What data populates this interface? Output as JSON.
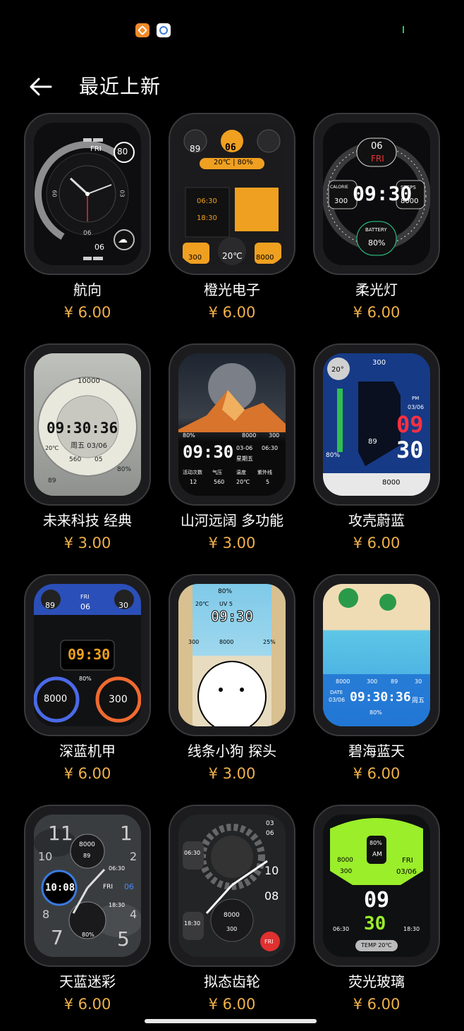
{
  "status": {
    "app_icons": [
      "orange-app-icon",
      "cloud-app-icon"
    ]
  },
  "header": {
    "title": "最近上新",
    "back_icon": "back-arrow-icon"
  },
  "colors": {
    "price": "#f0b14a",
    "background": "#000000"
  },
  "items": [
    {
      "name": "航向",
      "price": "¥ 6.00",
      "face": {
        "day": "FRI",
        "hr": "80",
        "n60": "60",
        "n03": "03",
        "n06": "06",
        "d06": "06"
      }
    },
    {
      "name": "橙光电子",
      "price": "¥ 6.00",
      "face": {
        "heart": "89",
        "date": "06",
        "temp": "20℃ | 80%",
        "sunrise": "06:30",
        "sunset": "18:30",
        "num1": "300",
        "num2": "20℃",
        "num3": "8000"
      }
    },
    {
      "name": "柔光灯",
      "price": "¥ 6.00",
      "face": {
        "date": "06",
        "day": "FRI",
        "time": "09:30",
        "cal_label": "CALORIE",
        "cal": "300",
        "steps_label": "STEPS",
        "steps": "8000",
        "bat_label": "BATTERY",
        "bat": "80%"
      }
    },
    {
      "name": "未来科技 经典",
      "price": "¥ 3.00",
      "face": {
        "steps": "10000",
        "time": "09:30:36",
        "date": "周五 03/06",
        "temp": "20℃",
        "n1": "560",
        "n2": "05",
        "heart": "89",
        "bat": "80%"
      }
    },
    {
      "name": "山河远阔 多功能",
      "price": "¥ 3.00",
      "face": {
        "time": "09:30",
        "date": "03-06",
        "day": "星期五",
        "sun": "06:30",
        "l1": "活动次数",
        "l2": "气压",
        "l3": "温度",
        "l4": "紫外线",
        "v1": "12",
        "v2": "560",
        "v3": "20℃",
        "v4": "5",
        "pct": "80%",
        "steps": "8000",
        "cal": "300"
      }
    },
    {
      "name": "攻壳蔚蓝",
      "price": "¥ 6.00",
      "face": {
        "temp": "20°",
        "cal": "300",
        "ampm": "PM",
        "date": "03/06",
        "hh": "09",
        "mm": "30",
        "heart": "89",
        "bat": "80%",
        "steps": "8000"
      }
    },
    {
      "name": "深蓝机甲",
      "price": "¥ 6.00",
      "face": {
        "heart": "89",
        "day": "FRI",
        "date": "06",
        "stat": "30",
        "time": "09:30",
        "pct": "80%",
        "steps": "8000",
        "cal": "300"
      }
    },
    {
      "name": "线条小狗 探头",
      "price": "¥ 3.00",
      "face": {
        "bat": "80%",
        "time": "09:30",
        "temp": "20℃",
        "uv": "UV 5",
        "cal": "300",
        "steps": "8000",
        "hum": "25%"
      }
    },
    {
      "name": "碧海蓝天",
      "price": "¥ 6.00",
      "face": {
        "steps": "8000",
        "cal": "300",
        "heart": "89",
        "stat": "30",
        "date_label": "DATE",
        "date": "03/06",
        "time": "09:30:36",
        "day": "周五",
        "pct": "80%"
      }
    },
    {
      "name": "天蓝迷彩",
      "price": "¥ 6.00",
      "face": {
        "n11": "11",
        "n1": "1",
        "n10": "10",
        "n2": "2",
        "n8": "8",
        "n4": "4",
        "n7": "7",
        "n5": "5",
        "steps": "8000",
        "heart": "89",
        "time": "10:08",
        "sunrise": "06:30",
        "day": "FRI",
        "date": "06",
        "sunset": "18:30",
        "bat": "80%"
      }
    },
    {
      "name": "拟态齿轮",
      "price": "¥ 6.00",
      "face": {
        "date": "03",
        "date2": "06",
        "sun1": "06:30",
        "h10": "10",
        "h08": "08",
        "steps": "8000",
        "cal": "300",
        "sun2": "18:30",
        "day": "FRI"
      }
    },
    {
      "name": "荧光玻璃",
      "price": "¥ 6.00",
      "face": {
        "pct": "80%",
        "ampm": "AM",
        "steps": "8000",
        "cal": "300",
        "day": "FRI",
        "date": "03/06",
        "hh": "09",
        "mm": "30",
        "sunrise": "06:30",
        "sunset": "18:30",
        "temp": "TEMP 20℃"
      }
    }
  ]
}
